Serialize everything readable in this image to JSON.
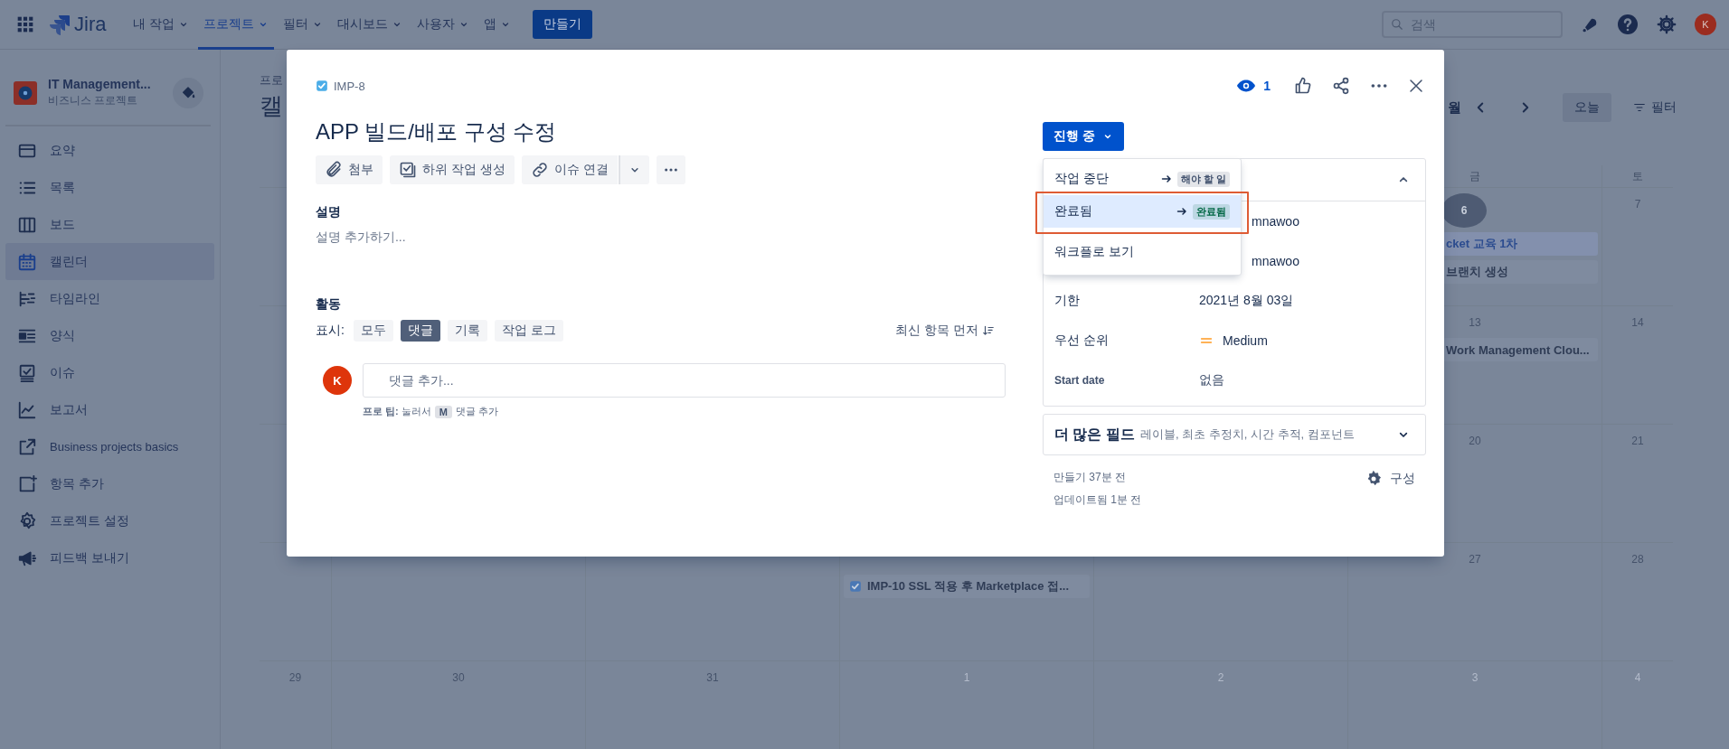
{
  "nav": {
    "logo": "Jira",
    "items": [
      {
        "label": "내 작업",
        "selected": false
      },
      {
        "label": "프로젝트",
        "selected": true
      },
      {
        "label": "필터",
        "selected": false
      },
      {
        "label": "대시보드",
        "selected": false
      },
      {
        "label": "사용자",
        "selected": false
      },
      {
        "label": "앱",
        "selected": false
      }
    ],
    "create": "만들기",
    "search": {
      "placeholder": "검색"
    },
    "avatar": "K"
  },
  "sidebar": {
    "project": {
      "name": "IT Management...",
      "type": "비즈니스 프로젝트"
    },
    "items": [
      {
        "label": "요약",
        "selected": false
      },
      {
        "label": "목록",
        "selected": false
      },
      {
        "label": "보드",
        "selected": false
      },
      {
        "label": "캘린더",
        "selected": true
      },
      {
        "label": "타임라인",
        "selected": false
      },
      {
        "label": "양식",
        "selected": false
      },
      {
        "label": "이슈",
        "selected": false
      },
      {
        "label": "보고서",
        "selected": false
      },
      {
        "label": "Business projects basics",
        "selected": false
      },
      {
        "label": "항목 추가",
        "selected": false
      },
      {
        "label": "프로젝트 설정",
        "selected": false
      },
      {
        "label": "피드백 보내기",
        "selected": false
      }
    ]
  },
  "calendar": {
    "breadcrumb": "프로",
    "title": "캘",
    "toolbar": {
      "view": "월",
      "today": "오늘",
      "filter": "필터"
    },
    "weekdays": [
      {
        "kind": "fri",
        "label": "금"
      },
      {
        "kind": "sat",
        "label": "토"
      }
    ],
    "weeks": [
      {
        "days": [
          {
            "kind": "fri",
            "date": "6",
            "today": true,
            "other_month": false,
            "events": [
              {
                "text": "cket 교육 1차",
                "kind": "clipped",
                "selected": true
              },
              {
                "text": "브랜치 생성",
                "kind": "clipped",
                "selected": false
              }
            ]
          },
          {
            "kind": "sat",
            "date": "7",
            "today": false,
            "other_month": false
          }
        ]
      },
      {
        "days": [
          {
            "kind": "fri",
            "date": "13",
            "today": false,
            "other_month": false,
            "events": [
              {
                "text": "Work Management Clou...",
                "kind": "clipped",
                "selected": false
              }
            ]
          },
          {
            "kind": "sat",
            "date": "14",
            "today": false,
            "other_month": false
          }
        ]
      },
      {
        "days": [
          {
            "kind": "fri",
            "date": "20",
            "today": false,
            "other_month": false
          },
          {
            "kind": "sat",
            "date": "21",
            "today": false,
            "other_month": false
          }
        ]
      },
      {
        "days": [
          {
            "kind": "wed",
            "events": [
              {
                "text": "IMP-10 SSL 적용 후 Marketplace 접...",
                "kind": "issue",
                "selected": false
              }
            ]
          },
          {
            "kind": "fri",
            "date": "27",
            "today": false,
            "other_month": false
          },
          {
            "kind": "sat",
            "date": "28",
            "today": false,
            "other_month": false
          }
        ]
      },
      {
        "days": [
          {
            "kind": "sun",
            "date": "29",
            "today": false,
            "other_month": false
          },
          {
            "kind": "mon",
            "date": "30",
            "today": false,
            "other_month": false
          },
          {
            "kind": "tue",
            "date": "31",
            "today": false,
            "other_month": false
          },
          {
            "kind": "wed",
            "date": "1",
            "today": false,
            "other_month": true
          },
          {
            "kind": "thu",
            "date": "2",
            "today": false,
            "other_month": true
          },
          {
            "kind": "fri",
            "date": "3",
            "today": false,
            "other_month": true
          },
          {
            "kind": "sat",
            "date": "4",
            "today": false,
            "other_month": true
          }
        ]
      }
    ]
  },
  "issue": {
    "key": "IMP-8",
    "watchers": "1",
    "title": "APP 빌드/배포 구성 수정",
    "actions": [
      {
        "label": "첨부"
      },
      {
        "label": "하위 작업 생성"
      },
      {
        "label": "이슈 연결"
      }
    ],
    "description": {
      "label": "설명",
      "placeholder": "설명 추가하기..."
    },
    "activity": {
      "label": "활동",
      "show": "표시:",
      "filters": [
        {
          "label": "모두",
          "selected": false
        },
        {
          "label": "댓글",
          "selected": true
        },
        {
          "label": "기록",
          "selected": false
        },
        {
          "label": "작업 로그",
          "selected": false
        }
      ],
      "sort": "최신 항목 먼저",
      "avatar": "K",
      "comment_placeholder": "댓글 추가...",
      "tip": "**프로 팁:** 눌러서",
      "tip_key": "M",
      "tip_end": "댓글 추가"
    },
    "status": {
      "label": "진행 중",
      "menu": [
        {
          "kind": "transition",
          "label": "작업 중단",
          "target": "해야 할 일",
          "color": "#42526e",
          "selected": false,
          "annotated": false
        },
        {
          "kind": "transition",
          "label": "완료됨",
          "target": "완료됨",
          "color": "#006644",
          "selected": true,
          "annotated": true
        },
        {
          "kind": "link",
          "label": "워크플로 보기",
          "selected": false,
          "annotated": false
        }
      ]
    },
    "details": {
      "expanded": true,
      "rows": [
        {
          "kind": "person",
          "value": "mnawoo"
        },
        {
          "kind": "person",
          "value": "mnawoo"
        },
        {
          "kind": "date",
          "label": "기한",
          "value": "2021년 8월 03일"
        },
        {
          "kind": "priority",
          "label": "우선 순위",
          "value": "Medium"
        },
        {
          "kind": "custom",
          "label": "Start date",
          "value": "없음"
        }
      ]
    },
    "more_fields": {
      "label": "더 많은 필드",
      "hint": "레이블, 최초 추정치, 시간 추적, 컴포넌트",
      "expanded": false
    },
    "created": "만들기 37분 전",
    "updated": "업데이트됨 1분 전",
    "configure": "구성"
  }
}
